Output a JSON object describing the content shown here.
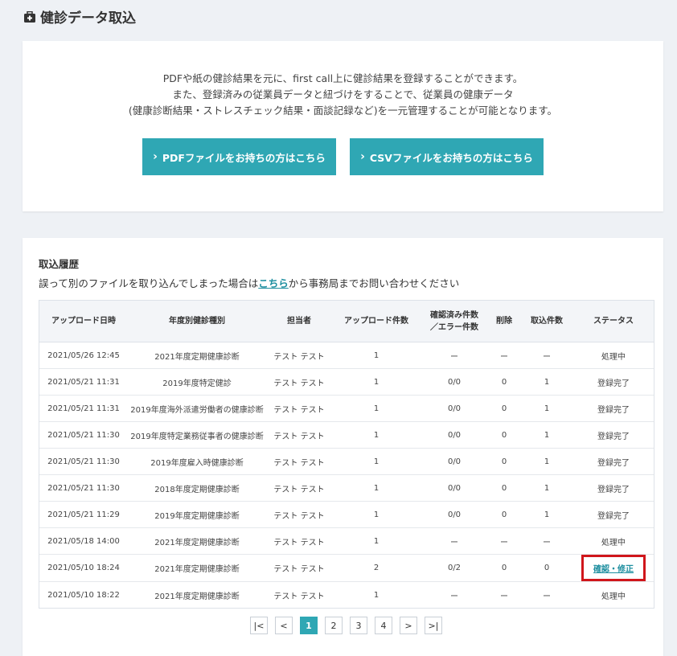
{
  "page": {
    "title": "健診データ取込",
    "title_icon": "medical-bag-icon"
  },
  "intro": {
    "lines": [
      "PDFや紙の健診結果を元に、first call上に健診結果を登録することができます。",
      "また、登録済みの従業員データと紐づけをすることで、従業員の健康データ",
      "(健康診断結果・ストレスチェック結果・面談記録など)を一元管理することが可能となります。"
    ],
    "pdf_button_label": "PDFファイルをお持ちの方はこちら",
    "csv_button_label": "CSVファイルをお持ちの方はこちら",
    "button_icon": "chevron-right-icon",
    "accent_color": "#2fa7b4"
  },
  "history": {
    "heading": "取込履歴",
    "note_before": "誤って別のファイルを取り込んでしまった場合は",
    "note_link": "こちら",
    "note_after": "から事務局までお問い合わせください",
    "columns": {
      "upload_datetime": "アップロード日時",
      "type": "年度別健診種別",
      "owner": "担当者",
      "upload_count": "アップロード件数",
      "confirmed_line1": "確認済み件数",
      "confirmed_line2": "／エラー件数",
      "deleted": "削除",
      "imported": "取込件数",
      "status": "ステータス"
    },
    "rows": [
      {
        "datetime": "2021/05/26 12:45",
        "type": "2021年度定期健康診断",
        "owner": "テスト テスト",
        "upload": "1",
        "confirmed": "ー",
        "deleted": "ー",
        "imported": "ー",
        "status": "処理中"
      },
      {
        "datetime": "2021/05/21 11:31",
        "type": "2019年度特定健診",
        "owner": "テスト テスト",
        "upload": "1",
        "confirmed": "0/0",
        "deleted": "0",
        "imported": "1",
        "status": "登録完了"
      },
      {
        "datetime": "2021/05/21 11:31",
        "type": "2019年度海外派遣労働者の健康診断",
        "owner": "テスト テスト",
        "upload": "1",
        "confirmed": "0/0",
        "deleted": "0",
        "imported": "1",
        "status": "登録完了"
      },
      {
        "datetime": "2021/05/21 11:30",
        "type": "2019年度特定業務従事者の健康診断",
        "owner": "テスト テスト",
        "upload": "1",
        "confirmed": "0/0",
        "deleted": "0",
        "imported": "1",
        "status": "登録完了"
      },
      {
        "datetime": "2021/05/21 11:30",
        "type": "2019年度雇入時健康診断",
        "owner": "テスト テスト",
        "upload": "1",
        "confirmed": "0/0",
        "deleted": "0",
        "imported": "1",
        "status": "登録完了"
      },
      {
        "datetime": "2021/05/21 11:30",
        "type": "2018年度定期健康診断",
        "owner": "テスト テスト",
        "upload": "1",
        "confirmed": "0/0",
        "deleted": "0",
        "imported": "1",
        "status": "登録完了"
      },
      {
        "datetime": "2021/05/21 11:29",
        "type": "2019年度定期健康診断",
        "owner": "テスト テスト",
        "upload": "1",
        "confirmed": "0/0",
        "deleted": "0",
        "imported": "1",
        "status": "登録完了"
      },
      {
        "datetime": "2021/05/18 14:00",
        "type": "2021年度定期健康診断",
        "owner": "テスト テスト",
        "upload": "1",
        "confirmed": "ー",
        "deleted": "ー",
        "imported": "ー",
        "status": "処理中"
      },
      {
        "datetime": "2021/05/10 18:24",
        "type": "2021年度定期健康診断",
        "owner": "テスト テスト",
        "upload": "2",
        "confirmed": "0/2",
        "deleted": "0",
        "imported": "0",
        "status": "確認・修正",
        "status_is_link": true
      },
      {
        "datetime": "2021/05/10 18:22",
        "type": "2021年度定期健康診断",
        "owner": "テスト テスト",
        "upload": "1",
        "confirmed": "ー",
        "deleted": "ー",
        "imported": "ー",
        "status": "処理中"
      }
    ],
    "highlight_color": "#d0161b"
  },
  "pagination": {
    "first": "|<",
    "prev": "<",
    "pages": [
      "1",
      "2",
      "3",
      "4"
    ],
    "current": "1",
    "next": ">",
    "last": ">|"
  }
}
